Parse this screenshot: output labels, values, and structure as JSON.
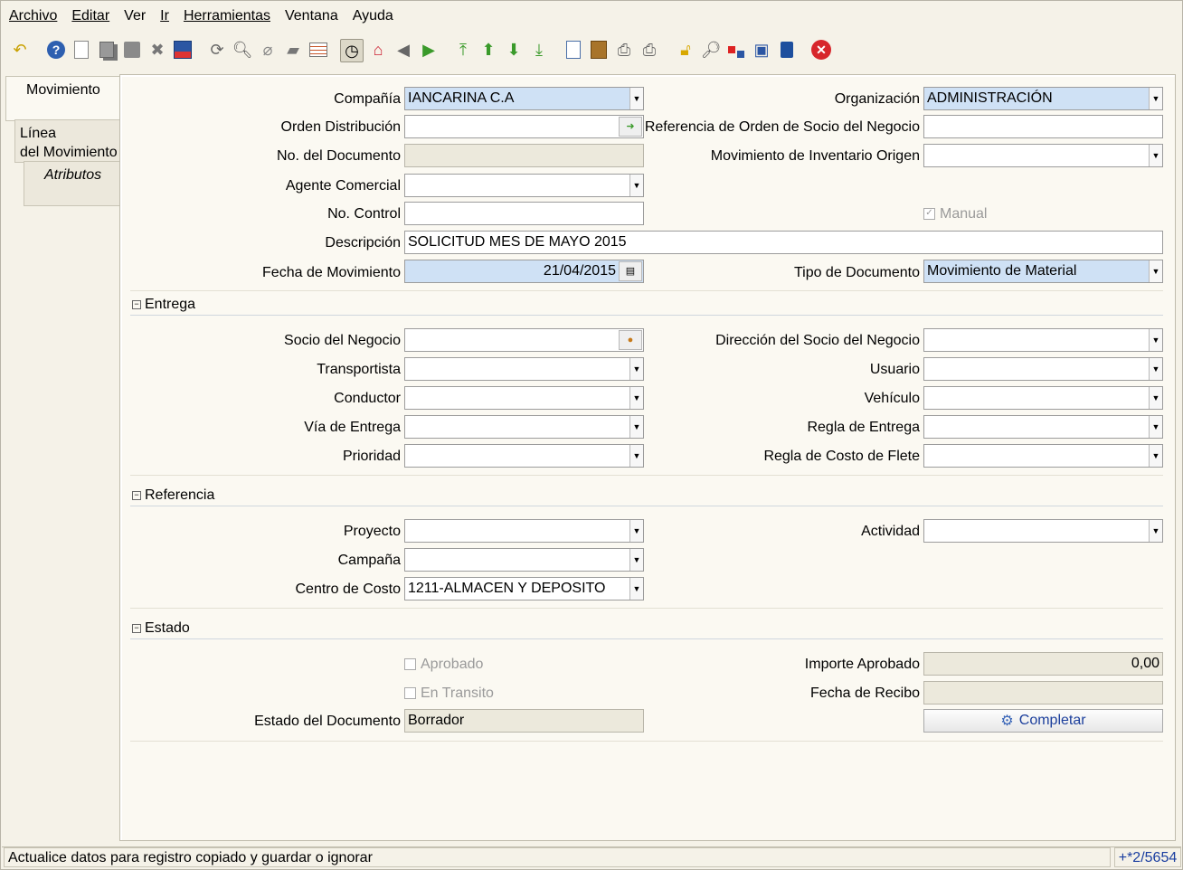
{
  "menu": [
    "Archivo",
    "Editar",
    "Ver",
    "Ir",
    "Herramientas",
    "Ventana",
    "Ayuda"
  ],
  "toolbar_icons": [
    "undo-icon",
    "help-icon",
    "new-icon",
    "copy-icon",
    "delete-icon",
    "delete-selection-icon",
    "save-icon",
    "refresh-icon",
    "find-icon",
    "attachment-icon",
    "chat-icon",
    "grid-toggle-icon",
    "history-icon",
    "home-icon",
    "previous-icon",
    "next-icon",
    "first-record-icon",
    "previous-record-icon",
    "next-record-icon",
    "last-record-icon",
    "report-icon",
    "archive-icon",
    "print-preview-icon",
    "print-icon",
    "lock-icon",
    "zoom-across-icon",
    "workflow-icon",
    "product-info-icon",
    "request-icon",
    "close-window-icon"
  ],
  "tabs": {
    "t1": "Movimiento",
    "t2a": "Línea",
    "t2b": "del Movimiento",
    "t3": "Atributos"
  },
  "form": {
    "compania": {
      "label": "Compañía",
      "value": "IANCARINA C.A"
    },
    "organizacion": {
      "label": "Organización",
      "value": "ADMINISTRACIÓN"
    },
    "orden_distribucion": {
      "label": "Orden Distribución",
      "value": ""
    },
    "ref_orden_socio": {
      "label": "Referencia de Orden de Socio del Negocio",
      "value": ""
    },
    "no_documento": {
      "label": "No. del Documento",
      "value": ""
    },
    "mov_inv_origen": {
      "label": "Movimiento de Inventario Origen",
      "value": ""
    },
    "agente_comercial": {
      "label": "Agente Comercial",
      "value": ""
    },
    "no_control": {
      "label": "No. Control",
      "value": ""
    },
    "manual": {
      "label": "Manual",
      "checked": true
    },
    "descripcion": {
      "label": "Descripción",
      "value": "SOLICITUD MES DE MAYO 2015"
    },
    "fecha_movimiento": {
      "label": "Fecha de Movimiento",
      "value": "21/04/2015"
    },
    "tipo_documento": {
      "label": "Tipo de Documento",
      "value": "Movimiento de Material"
    }
  },
  "sections": {
    "entrega": "Entrega",
    "referencia": "Referencia",
    "estado": "Estado"
  },
  "entrega": {
    "socio": {
      "label": "Socio del Negocio",
      "value": ""
    },
    "direccion_socio": {
      "label": "Dirección del Socio del Negocio",
      "value": ""
    },
    "transportista": {
      "label": "Transportista",
      "value": ""
    },
    "usuario": {
      "label": "Usuario",
      "value": ""
    },
    "conductor": {
      "label": "Conductor",
      "value": ""
    },
    "vehiculo": {
      "label": "Vehículo",
      "value": ""
    },
    "via_entrega": {
      "label": "Vía de Entrega",
      "value": ""
    },
    "regla_entrega": {
      "label": "Regla de Entrega",
      "value": ""
    },
    "prioridad": {
      "label": "Prioridad",
      "value": ""
    },
    "regla_costo_flete": {
      "label": "Regla de Costo de Flete",
      "value": ""
    }
  },
  "referencia": {
    "proyecto": {
      "label": "Proyecto",
      "value": ""
    },
    "actividad": {
      "label": "Actividad",
      "value": ""
    },
    "campana": {
      "label": "Campaña",
      "value": ""
    },
    "centro_costo": {
      "label": "Centro de Costo",
      "value": "1211-ALMACEN Y DEPOSITO"
    }
  },
  "estado": {
    "aprobado": {
      "label": "Aprobado",
      "checked": false
    },
    "importe_aprobado": {
      "label": "Importe Aprobado",
      "value": "0,00"
    },
    "en_transito": {
      "label": "En Transito",
      "checked": false
    },
    "fecha_recibo": {
      "label": "Fecha de Recibo",
      "value": ""
    },
    "estado_documento": {
      "label": "Estado del Documento",
      "value": "Borrador"
    },
    "completar": "Completar"
  },
  "status": {
    "message": "Actualice datos para registro copiado y guardar o ignorar",
    "record": "+*2/5654"
  },
  "colors": {
    "mandatory": "#cfe1f5",
    "readonly": "#ece9dc",
    "accent": "#1c3f9c",
    "close": "#d7262b"
  }
}
